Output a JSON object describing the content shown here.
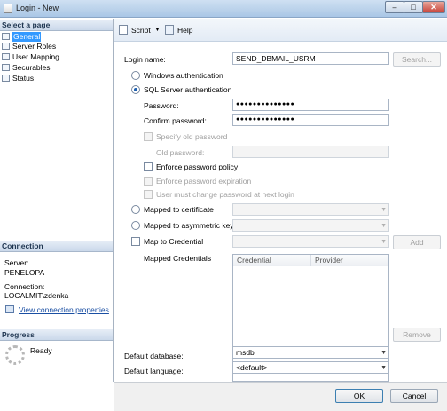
{
  "window": {
    "title": "Login - New",
    "min": "–",
    "max": "□",
    "close": "✕"
  },
  "left": {
    "select_page_header": "Select a page",
    "pages": [
      "General",
      "Server Roles",
      "User Mapping",
      "Securables",
      "Status"
    ],
    "connection_header": "Connection",
    "server_label": "Server:",
    "server_value": "PENELOPA",
    "connection_label": "Connection:",
    "connection_value": "LOCALMIT\\zdenka",
    "view_connection_link": "View connection properties",
    "progress_header": "Progress",
    "progress_status": "Ready"
  },
  "toolbar": {
    "script_label": "Script",
    "script_dropdown": "▼",
    "help_label": "Help"
  },
  "form": {
    "login_name_label": "Login name:",
    "login_name_value": "SEND_DBMAIL_USRM",
    "search_button": "Search...",
    "windows_auth": "Windows authentication",
    "sql_auth": "SQL Server authentication",
    "password_label": "Password:",
    "password_value": "●●●●●●●●●●●●●●",
    "confirm_password_label": "Confirm password:",
    "confirm_password_value": "●●●●●●●●●●●●●●",
    "specify_old_password": "Specify old password",
    "old_password_label": "Old password:",
    "enforce_policy": "Enforce password policy",
    "enforce_expiration": "Enforce password expiration",
    "must_change": "User must change password at next login",
    "mapped_certificate": "Mapped to certificate",
    "mapped_asymmetric": "Mapped to asymmetric key",
    "map_credential": "Map to Credential",
    "add_button": "Add",
    "mapped_credentials_label": "Mapped Credentials",
    "credentials_columns": [
      "Credential",
      "Provider"
    ],
    "remove_button": "Remove",
    "default_database_label": "Default database:",
    "default_database_value": "msdb",
    "default_language_label": "Default language:",
    "default_language_value": "<default>"
  },
  "footer": {
    "ok_button": "OK",
    "cancel_button": "Cancel"
  }
}
